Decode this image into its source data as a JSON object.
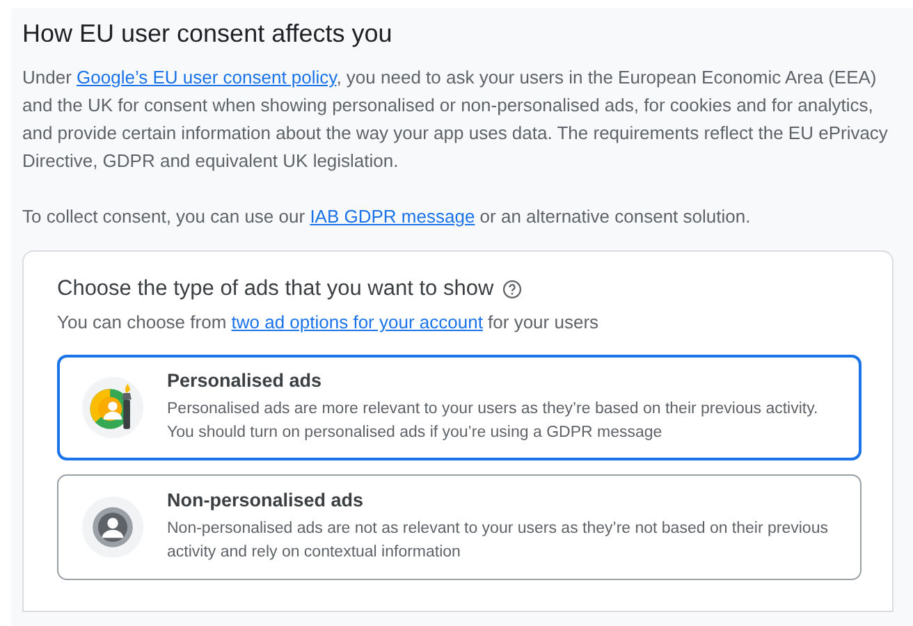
{
  "heading": "How EU user consent affects you",
  "intro": {
    "before": "Under ",
    "link": "Google’s EU user consent policy",
    "after": ", you need to ask your users in the European Economic Area (EEA) and the UK for consent when showing personalised or non-personalised ads, for cookies and for analytics, and provide certain information about the way your app uses data. The requirements reflect the EU ePrivacy Directive, GDPR and equivalent UK legislation."
  },
  "collect": {
    "before": "To collect consent, you can use our ",
    "link": "IAB GDPR message",
    "after": " or an alternative consent solution."
  },
  "card": {
    "title": "Choose the type of ads that you want to show",
    "subtitle": {
      "before": "You can choose from ",
      "link": "two ad options for your account",
      "after": " for your users"
    },
    "options": [
      {
        "kind": "personalised",
        "title": "Personalised ads",
        "description": "Personalised ads are more relevant to your users as they’re based on their previous activity. You should turn on personalised ads if you’re using a GDPR message",
        "selected": true
      },
      {
        "kind": "non_personalised",
        "title": "Non-personalised ads",
        "description": "Non-personalised ads are not as relevant to your users as they’re not based on their previous activity and rely on contextual information",
        "selected": false
      }
    ]
  }
}
